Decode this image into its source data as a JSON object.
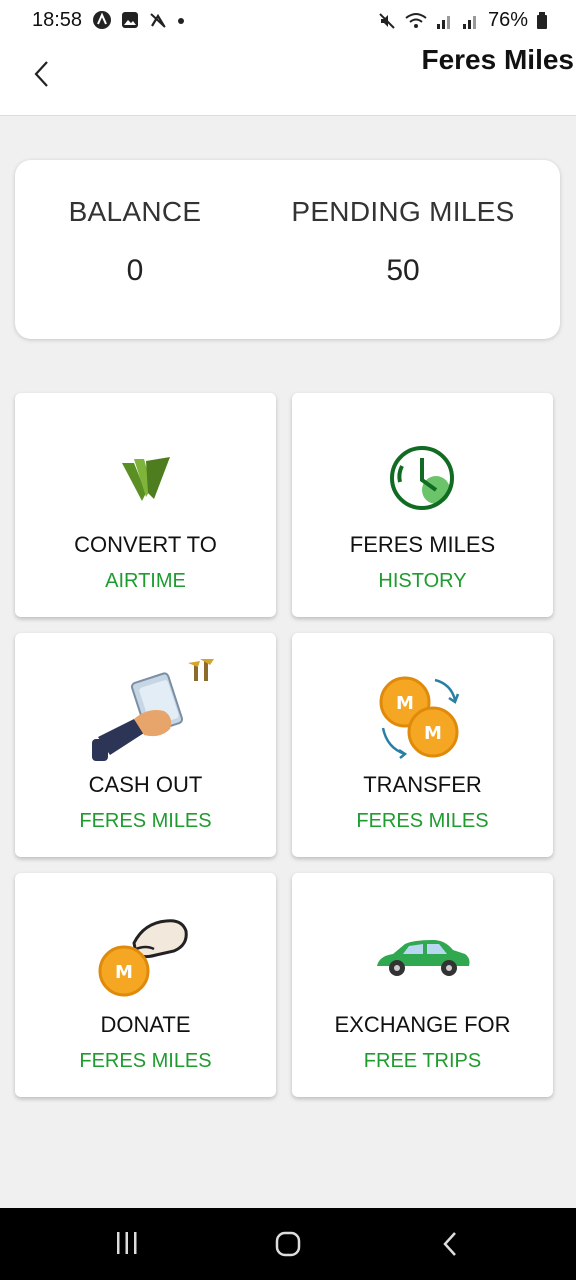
{
  "status_bar": {
    "time": "18:58",
    "battery": "76%"
  },
  "header": {
    "title": "Feres Miles"
  },
  "balance": {
    "balance_label": "BALANCE",
    "balance_value": "0",
    "pending_label": "PENDING MILES",
    "pending_value": "50"
  },
  "tiles": [
    {
      "line1": "CONVERT TO",
      "line2": "AIRTIME",
      "icon": "airtime-leaf-icon"
    },
    {
      "line1": "FERES MILES",
      "line2": "HISTORY",
      "icon": "clock-icon"
    },
    {
      "line1": "CASH OUT",
      "line2": "FERES MILES",
      "icon": "cash-hand-icon"
    },
    {
      "line1": "TRANSFER",
      "line2": "FERES MILES",
      "icon": "coin-transfer-icon"
    },
    {
      "line1": "DONATE",
      "line2": "FERES MILES",
      "icon": "donate-coin-icon"
    },
    {
      "line1": "EXCHANGE FOR",
      "line2": "FREE TRIPS",
      "icon": "car-icon"
    }
  ],
  "colors": {
    "accent_green": "#1e9c2e",
    "background": "#f0f0f0"
  }
}
